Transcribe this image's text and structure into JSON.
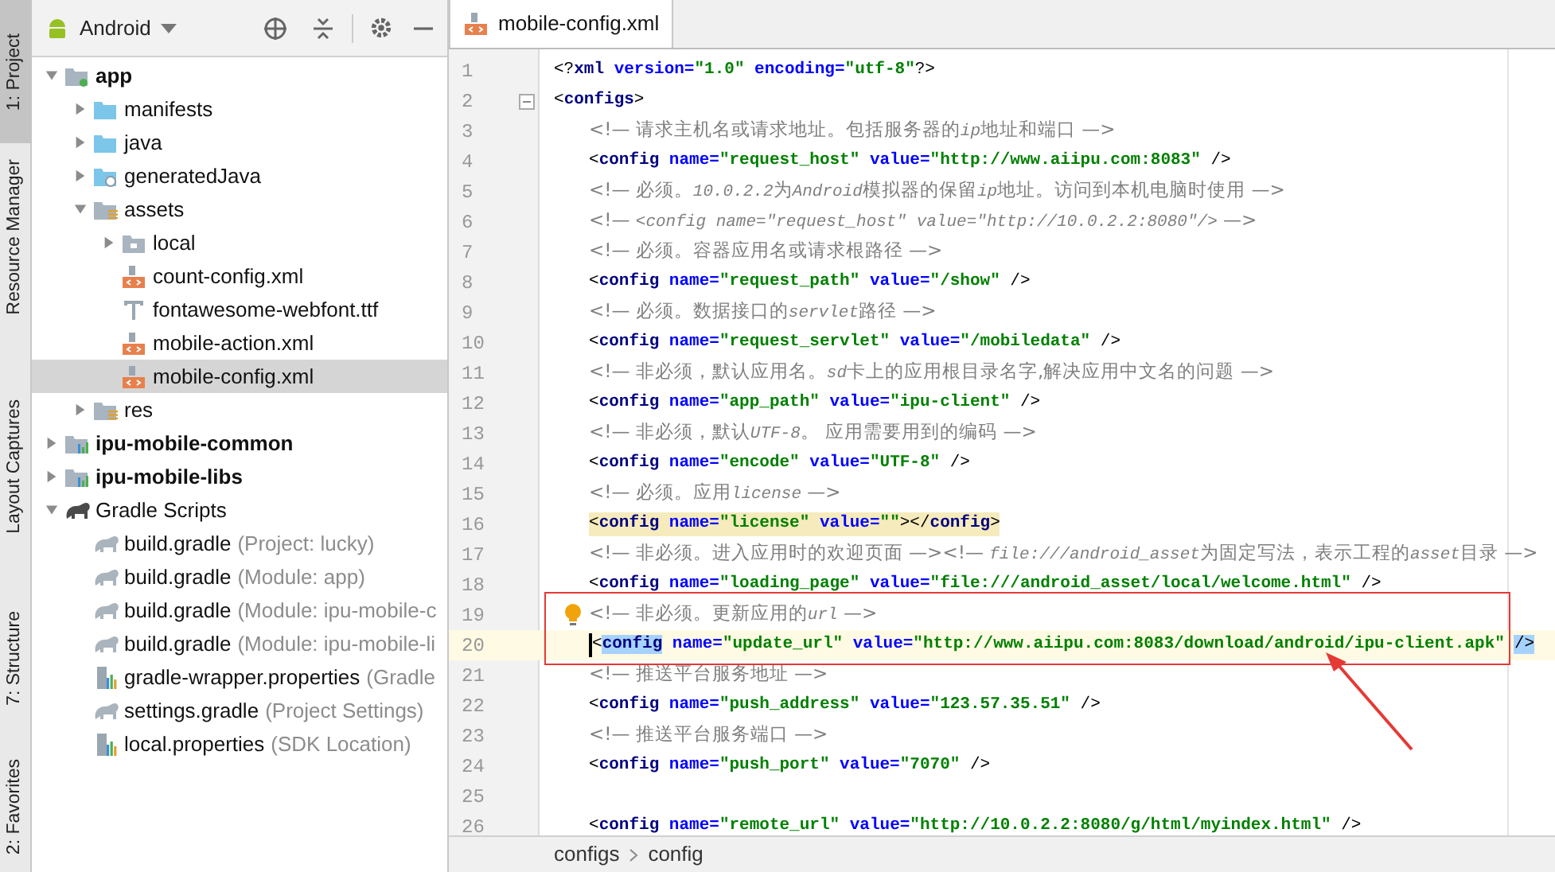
{
  "tool_windows": [
    {
      "label": "1: Project",
      "selected": true
    },
    {
      "label": "Resource Manager",
      "selected": false
    },
    {
      "label": "Layout Captures",
      "selected": false
    },
    {
      "label": "7: Structure",
      "selected": false
    },
    {
      "label": "2: Favorites",
      "selected": false
    }
  ],
  "project_panel": {
    "view": "Android",
    "tree": [
      {
        "label": "app",
        "kind": "module",
        "expanded": true,
        "selected": false,
        "children": [
          {
            "label": "manifests",
            "kind": "folder",
            "expanded": false,
            "selected": false
          },
          {
            "label": "java",
            "kind": "folder",
            "expanded": false,
            "selected": false
          },
          {
            "label": "generatedJava",
            "kind": "generated-folder",
            "expanded": false,
            "selected": false
          },
          {
            "label": "assets",
            "kind": "resource-folder",
            "expanded": true,
            "selected": false,
            "children": [
              {
                "label": "local",
                "kind": "plain-folder",
                "expanded": false,
                "selected": false
              },
              {
                "label": "count-config.xml",
                "kind": "xml",
                "selected": false
              },
              {
                "label": "fontawesome-webfont.ttf",
                "kind": "font",
                "selected": false
              },
              {
                "label": "mobile-action.xml",
                "kind": "xml",
                "selected": false
              },
              {
                "label": "mobile-config.xml",
                "kind": "xml",
                "selected": true
              }
            ]
          },
          {
            "label": "res",
            "kind": "resource-folder",
            "expanded": false,
            "selected": false
          }
        ]
      },
      {
        "label": "ipu-mobile-common",
        "kind": "library",
        "expanded": false,
        "selected": false
      },
      {
        "label": "ipu-mobile-libs",
        "kind": "library",
        "expanded": false,
        "selected": false
      },
      {
        "label": "Gradle Scripts",
        "kind": "gradle-root",
        "expanded": true,
        "selected": false,
        "children": [
          {
            "label": "build.gradle",
            "hint": "(Project: lucky)",
            "kind": "gradle",
            "selected": false
          },
          {
            "label": "build.gradle",
            "hint": "(Module: app)",
            "kind": "gradle",
            "selected": false
          },
          {
            "label": "build.gradle",
            "hint": "(Module: ipu-mobile-c",
            "kind": "gradle",
            "selected": false
          },
          {
            "label": "build.gradle",
            "hint": "(Module: ipu-mobile-li",
            "kind": "gradle",
            "selected": false
          },
          {
            "label": "gradle-wrapper.properties",
            "hint": "(Gradle",
            "kind": "properties",
            "selected": false
          },
          {
            "label": "settings.gradle",
            "hint": "(Project Settings)",
            "kind": "gradle",
            "selected": false
          },
          {
            "label": "local.properties",
            "hint": "(SDK Location)",
            "kind": "properties",
            "selected": false
          }
        ]
      }
    ]
  },
  "editor": {
    "tabs": [
      {
        "label": "mobile-config.xml",
        "selected": true
      }
    ],
    "lines": [
      {
        "number": "1",
        "tokens": [
          {
            "kind": "punct",
            "text": "<?"
          },
          {
            "kind": "tag",
            "text": "xml"
          },
          {
            "kind": "attr",
            "text": " version="
          },
          {
            "kind": "value",
            "text": "\"1.0\""
          },
          {
            "kind": "attr",
            "text": " encoding="
          },
          {
            "kind": "value",
            "text": "\"utf-8\""
          },
          {
            "kind": "punct",
            "text": "?>"
          }
        ]
      },
      {
        "number": "2",
        "foldable": true,
        "tokens": [
          {
            "kind": "punct",
            "text": "<"
          },
          {
            "kind": "tag",
            "text": "configs"
          },
          {
            "kind": "punct",
            "text": ">"
          }
        ],
        "children": [
          {
            "number": "3",
            "tokens": [
              {
                "kind": "comment",
                "text": "<!— 请求主机名或请求地址。包括服务器的"
              },
              {
                "kind": "comment-code",
                "text": "ip"
              },
              {
                "kind": "comment",
                "text": "地址和端口 —>"
              }
            ]
          },
          {
            "number": "4",
            "tokens": [
              {
                "kind": "punct",
                "text": "<"
              },
              {
                "kind": "tag",
                "text": "config"
              },
              {
                "kind": "attr",
                "text": " name="
              },
              {
                "kind": "value",
                "text": "\"request_host\""
              },
              {
                "kind": "attr",
                "text": " value="
              },
              {
                "kind": "value",
                "text": "\"http://www.aiipu.com:8083\""
              },
              {
                "kind": "punct",
                "text": " />"
              }
            ]
          },
          {
            "number": "5",
            "tokens": [
              {
                "kind": "comment",
                "text": "<!— 必须。"
              },
              {
                "kind": "comment-code",
                "text": "10.0.2.2"
              },
              {
                "kind": "comment",
                "text": "为"
              },
              {
                "kind": "comment-code",
                "text": "Android"
              },
              {
                "kind": "comment",
                "text": "模拟器的保留"
              },
              {
                "kind": "comment-code",
                "text": "ip"
              },
              {
                "kind": "comment",
                "text": "地址。访问到本机电脑时使用 —>"
              }
            ]
          },
          {
            "number": "6",
            "tokens": [
              {
                "kind": "comment",
                "text": "<!— "
              },
              {
                "kind": "comment-code",
                "text": "<config name=\"request_host\" value=\"http://10.0.2.2:8080\"/>"
              },
              {
                "kind": "comment",
                "text": " —>"
              }
            ]
          },
          {
            "number": "7",
            "tokens": [
              {
                "kind": "comment",
                "text": "<!— 必须。容器应用名或请求根路径 —>"
              }
            ]
          },
          {
            "number": "8",
            "tokens": [
              {
                "kind": "punct",
                "text": "<"
              },
              {
                "kind": "tag",
                "text": "config"
              },
              {
                "kind": "attr",
                "text": " name="
              },
              {
                "kind": "value",
                "text": "\"request_path\""
              },
              {
                "kind": "attr",
                "text": " value="
              },
              {
                "kind": "value",
                "text": "\"/show\""
              },
              {
                "kind": "punct",
                "text": " />"
              }
            ]
          },
          {
            "number": "9",
            "tokens": [
              {
                "kind": "comment",
                "text": "<!— 必须。数据接口的"
              },
              {
                "kind": "comment-code",
                "text": "servlet"
              },
              {
                "kind": "comment",
                "text": "路径 —>"
              }
            ]
          },
          {
            "number": "10",
            "tokens": [
              {
                "kind": "punct",
                "text": "<"
              },
              {
                "kind": "tag",
                "text": "config"
              },
              {
                "kind": "attr",
                "text": " name="
              },
              {
                "kind": "value",
                "text": "\"request_servlet\""
              },
              {
                "kind": "attr",
                "text": " value="
              },
              {
                "kind": "value",
                "text": "\"/mobiledata\""
              },
              {
                "kind": "punct",
                "text": " />"
              }
            ]
          },
          {
            "number": "11",
            "tokens": [
              {
                "kind": "comment",
                "text": "<!— 非必须，默认应用名。"
              },
              {
                "kind": "comment-code",
                "text": "sd"
              },
              {
                "kind": "comment",
                "text": "卡上的应用根目录名字,解决应用中文名的问题 —>"
              }
            ]
          },
          {
            "number": "12",
            "tokens": [
              {
                "kind": "punct",
                "text": "<"
              },
              {
                "kind": "tag",
                "text": "config"
              },
              {
                "kind": "attr",
                "text": " name="
              },
              {
                "kind": "value",
                "text": "\"app_path\""
              },
              {
                "kind": "attr",
                "text": " value="
              },
              {
                "kind": "value",
                "text": "\"ipu-client\""
              },
              {
                "kind": "punct",
                "text": " />"
              }
            ]
          },
          {
            "number": "13",
            "tokens": [
              {
                "kind": "comment",
                "text": "<!— 非必须，默认"
              },
              {
                "kind": "comment-code",
                "text": "UTF-8"
              },
              {
                "kind": "comment",
                "text": "。 应用需要用到的编码 —>"
              }
            ]
          },
          {
            "number": "14",
            "tokens": [
              {
                "kind": "punct",
                "text": "<"
              },
              {
                "kind": "tag",
                "text": "config"
              },
              {
                "kind": "attr",
                "text": " name="
              },
              {
                "kind": "value",
                "text": "\"encode\""
              },
              {
                "kind": "attr",
                "text": " value="
              },
              {
                "kind": "value",
                "text": "\"UTF-8\""
              },
              {
                "kind": "punct",
                "text": " />"
              }
            ]
          },
          {
            "number": "15",
            "tokens": [
              {
                "kind": "comment",
                "text": "<!— 必须。应用"
              },
              {
                "kind": "comment-code",
                "text": "license"
              },
              {
                "kind": "comment",
                "text": " —>"
              }
            ]
          },
          {
            "number": "16",
            "highlighted": true,
            "tokens": [
              {
                "kind": "punct",
                "text": "<"
              },
              {
                "kind": "tag",
                "text": "config"
              },
              {
                "kind": "attr",
                "text": " name="
              },
              {
                "kind": "value",
                "text": "\"license\""
              },
              {
                "kind": "attr",
                "text": " value="
              },
              {
                "kind": "value",
                "text": "\"\""
              },
              {
                "kind": "punct",
                "text": "></"
              },
              {
                "kind": "tag",
                "text": "config"
              },
              {
                "kind": "punct",
                "text": ">"
              }
            ]
          },
          {
            "number": "17",
            "tokens": [
              {
                "kind": "comment",
                "text": "<!— 非必须。进入应用时的欢迎页面 —><!— "
              },
              {
                "kind": "comment-code",
                "text": "file:///android_asset"
              },
              {
                "kind": "comment",
                "text": "为固定写法，表示工程的"
              },
              {
                "kind": "comment-code",
                "text": "asset"
              },
              {
                "kind": "comment",
                "text": "目录 —>"
              }
            ]
          },
          {
            "number": "18",
            "tokens": [
              {
                "kind": "punct",
                "text": "<"
              },
              {
                "kind": "tag",
                "text": "config"
              },
              {
                "kind": "attr",
                "text": " name="
              },
              {
                "kind": "value",
                "text": "\"loading_page\""
              },
              {
                "kind": "attr",
                "text": " value="
              },
              {
                "kind": "value",
                "text": "\"file:///android_asset/local/welcome.html\""
              },
              {
                "kind": "punct",
                "text": " />"
              }
            ]
          },
          {
            "number": "19",
            "bulb": true,
            "tokens": [
              {
                "kind": "comment",
                "text": "<!— 非必须。更新应用的"
              },
              {
                "kind": "comment-code",
                "text": "url"
              },
              {
                "kind": "comment",
                "text": " —>"
              }
            ]
          },
          {
            "number": "20",
            "current": true,
            "tokens": [
              {
                "kind": "punct",
                "text": "<"
              },
              {
                "kind": "tag",
                "text": "config",
                "selected": true
              },
              {
                "kind": "attr",
                "text": " name="
              },
              {
                "kind": "value",
                "text": "\"update_url\""
              },
              {
                "kind": "attr",
                "text": " value="
              },
              {
                "kind": "value",
                "text": "\"http://www.aiipu.com:8083/download/android/ipu-client.apk\""
              },
              {
                "kind": "punct",
                "text": "/>",
                "selected": true
              }
            ]
          },
          {
            "number": "21",
            "tokens": [
              {
                "kind": "comment",
                "text": "<!— 推送平台服务地址 —>"
              }
            ]
          },
          {
            "number": "22",
            "tokens": [
              {
                "kind": "punct",
                "text": "<"
              },
              {
                "kind": "tag",
                "text": "config"
              },
              {
                "kind": "attr",
                "text": " name="
              },
              {
                "kind": "value",
                "text": "\"push_address\""
              },
              {
                "kind": "attr",
                "text": " value="
              },
              {
                "kind": "value",
                "text": "\"123.57.35.51\""
              },
              {
                "kind": "punct",
                "text": " />"
              }
            ]
          },
          {
            "number": "23",
            "tokens": [
              {
                "kind": "comment",
                "text": "<!— 推送平台服务端口 —>"
              }
            ]
          },
          {
            "number": "24",
            "tokens": [
              {
                "kind": "punct",
                "text": "<"
              },
              {
                "kind": "tag",
                "text": "config"
              },
              {
                "kind": "attr",
                "text": " name="
              },
              {
                "kind": "value",
                "text": "\"push_port\""
              },
              {
                "kind": "attr",
                "text": " value="
              },
              {
                "kind": "value",
                "text": "\"7070\""
              },
              {
                "kind": "punct",
                "text": " />"
              }
            ]
          },
          {
            "number": "25"
          },
          {
            "number": "26",
            "tokens": [
              {
                "kind": "punct",
                "text": "<"
              },
              {
                "kind": "tag",
                "text": "config"
              },
              {
                "kind": "attr",
                "text": " name="
              },
              {
                "kind": "value",
                "text": "\"remote_url\""
              },
              {
                "kind": "attr",
                "text": " value="
              },
              {
                "kind": "value",
                "text": "\"http://10.0.2.2:8080/g/html/myindex.html\""
              },
              {
                "kind": "punct",
                "text": " />"
              }
            ]
          }
        ]
      }
    ],
    "breadcrumbs": [
      "configs",
      "config"
    ]
  }
}
